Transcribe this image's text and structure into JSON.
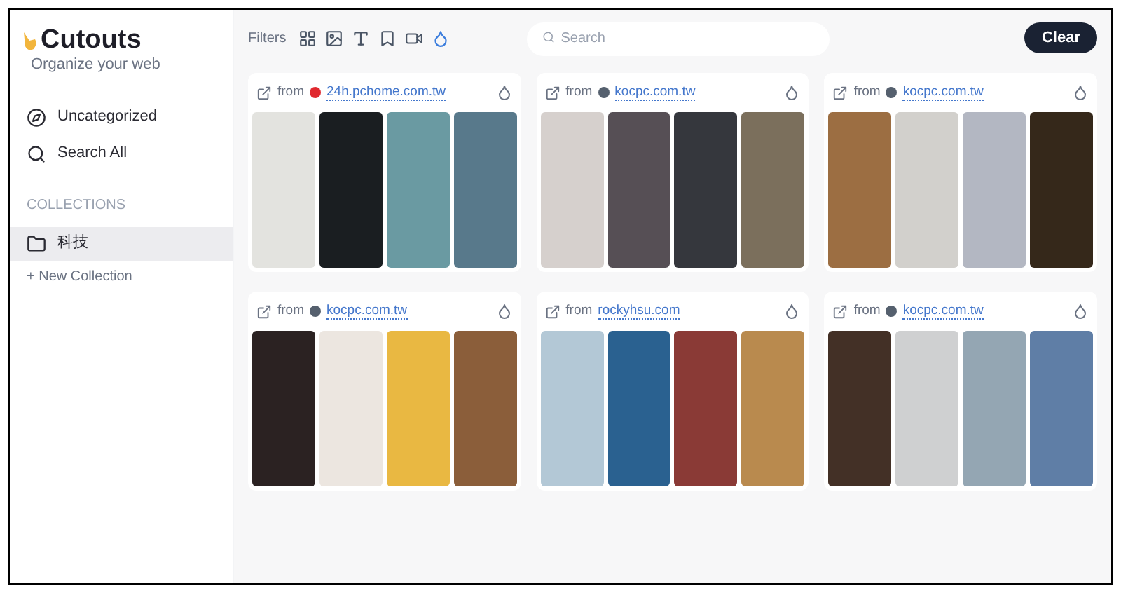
{
  "app": {
    "title": "Cutouts",
    "tagline": "Organize your web"
  },
  "nav": [
    {
      "label": "Uncategorized",
      "kind": "compass",
      "selected": false
    },
    {
      "label": "Search All",
      "kind": "search",
      "selected": false
    }
  ],
  "collections": {
    "heading": "COLLECTIONS",
    "items": [
      {
        "label": "科技",
        "selected": true
      }
    ],
    "new_label": "+ New Collection"
  },
  "toolbar": {
    "filters_label": "Filters",
    "filters": [
      {
        "kind": "grid",
        "selected": false
      },
      {
        "kind": "image",
        "selected": false
      },
      {
        "kind": "text",
        "selected": false
      },
      {
        "kind": "bookmark",
        "selected": false
      },
      {
        "kind": "video",
        "selected": false
      },
      {
        "kind": "color",
        "selected": true
      }
    ],
    "search": {
      "placeholder": "Search"
    },
    "clear_button": "Clear"
  },
  "cards": [
    {
      "from": "from",
      "source": "24h.pchome.com.tw",
      "favicon": {
        "color": "#e0282e"
      },
      "swatches": [
        {
          "color": "#e3e3df"
        },
        {
          "color": "#1a1e21"
        },
        {
          "color": "#6a9aa2"
        },
        {
          "color": "#58798b"
        }
      ]
    },
    {
      "from": "from",
      "source": "kocpc.com.tw",
      "favicon": {
        "color": "#55606e"
      },
      "swatches": [
        {
          "color": "#d6d0cd"
        },
        {
          "color": "#564f55"
        },
        {
          "color": "#35373d"
        },
        {
          "color": "#7b6f5c"
        }
      ]
    },
    {
      "from": "from",
      "source": "kocpc.com.tw",
      "favicon": {
        "color": "#55606e"
      },
      "swatches": [
        {
          "color": "#9c6e42"
        },
        {
          "color": "#d2d0cc"
        },
        {
          "color": "#b3b7c2"
        },
        {
          "color": "#35281a"
        }
      ]
    },
    {
      "from": "from",
      "source": "kocpc.com.tw",
      "favicon": {
        "color": "#55606e"
      },
      "swatches": [
        {
          "color": "#2b2222"
        },
        {
          "color": "#ece6e0"
        },
        {
          "color": "#e9b842"
        },
        {
          "color": "#8b5e3a"
        }
      ]
    },
    {
      "from": "from",
      "source": "rockyhsu.com",
      "swatches": [
        {
          "color": "#b3c8d6"
        },
        {
          "color": "#2a6190"
        },
        {
          "color": "#8a3a36"
        },
        {
          "color": "#b98a4e"
        }
      ]
    },
    {
      "from": "from",
      "source": "kocpc.com.tw",
      "favicon": {
        "color": "#55606e"
      },
      "swatches": [
        {
          "color": "#433026"
        },
        {
          "color": "#cfd0d1"
        },
        {
          "color": "#94a6b3"
        },
        {
          "color": "#5f7ea6"
        }
      ]
    }
  ]
}
